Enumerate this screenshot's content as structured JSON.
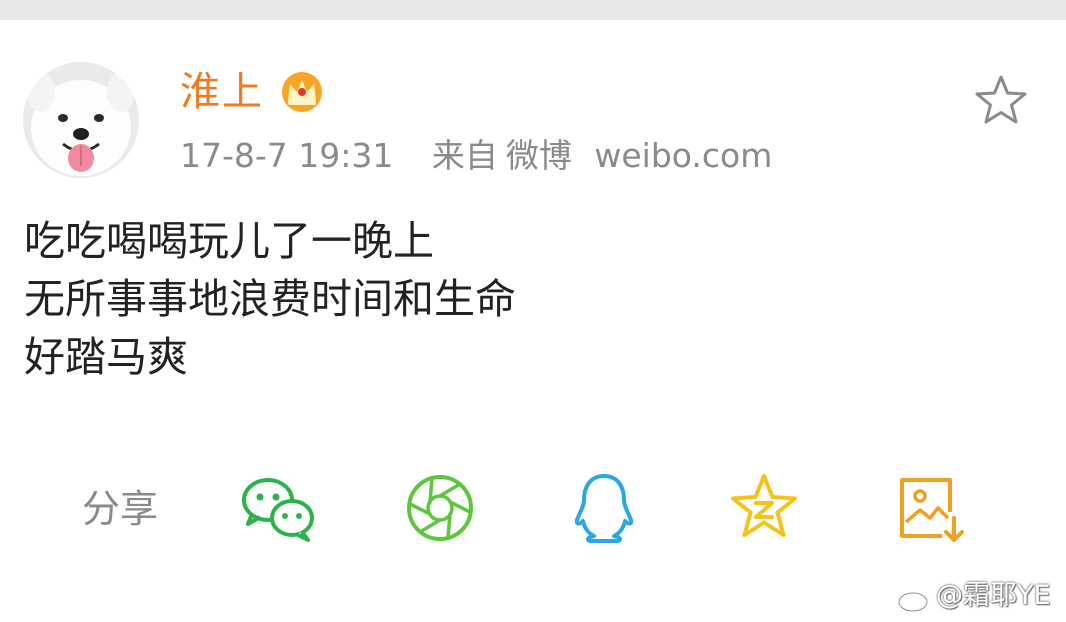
{
  "post": {
    "author": {
      "name": "淮上",
      "badge_icon": "crown-icon",
      "badge_color": "#f0a020"
    },
    "timestamp": "17-8-7 19:31",
    "source_prefix": "来自",
    "source_app": "微博",
    "source_site": "weibo.com",
    "content_lines": [
      "吃吃喝喝玩儿了一晚上",
      "无所事事地浪费时间和生命",
      "好踏马爽"
    ],
    "favorite_icon": "star-outline-icon"
  },
  "share": {
    "label": "分享",
    "targets": [
      {
        "name": "wechat-icon",
        "color": "#2bb34a"
      },
      {
        "name": "moments-icon",
        "color": "#5cc63c"
      },
      {
        "name": "qq-icon",
        "color": "#2aa6e6"
      },
      {
        "name": "qzone-icon",
        "color": "#f5c218"
      },
      {
        "name": "save-image-icon",
        "color": "#f0a020"
      }
    ]
  },
  "watermark": {
    "text": "@霜耶YE"
  },
  "colors": {
    "username": "#f07a1f",
    "meta": "#8a8a8a",
    "text": "#222222",
    "background": "#ffffff"
  }
}
